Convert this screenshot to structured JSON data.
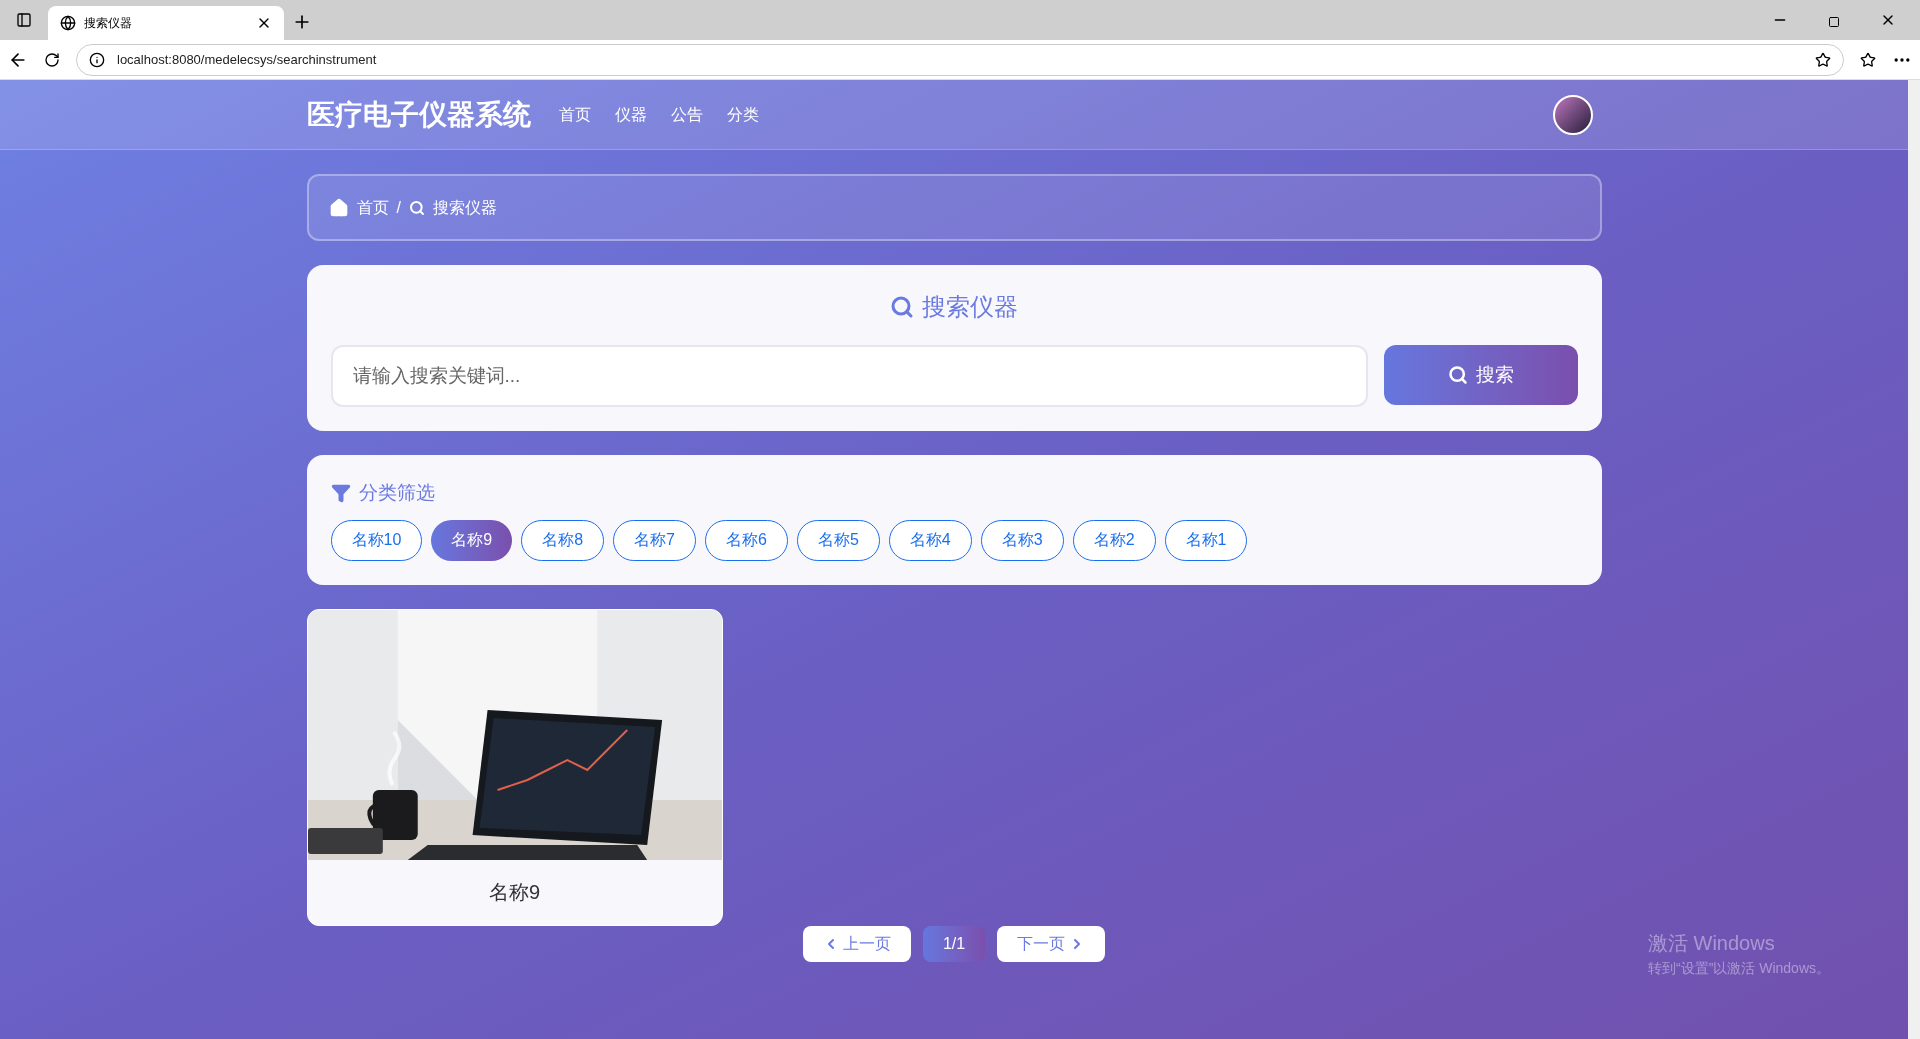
{
  "browser": {
    "tab_title": "搜索仪器",
    "url": "localhost:8080/medelecsys/searchinstrument"
  },
  "header": {
    "logo": "医疗电子仪器系统",
    "nav": [
      {
        "label": "首页"
      },
      {
        "label": "仪器"
      },
      {
        "label": "公告"
      },
      {
        "label": "分类"
      }
    ]
  },
  "breadcrumb": [
    {
      "kind": "home",
      "label": "首页"
    },
    {
      "kind": "search",
      "label": "搜索仪器"
    }
  ],
  "breadcrumb_separator": "/",
  "search": {
    "title": "搜索仪器",
    "placeholder": "请输入搜索关键词...",
    "button": "搜索"
  },
  "filter": {
    "title": "分类筛选",
    "categories": [
      {
        "label": "名称10",
        "selected": false
      },
      {
        "label": "名称9",
        "selected": true
      },
      {
        "label": "名称8",
        "selected": false
      },
      {
        "label": "名称7",
        "selected": false
      },
      {
        "label": "名称6",
        "selected": false
      },
      {
        "label": "名称5",
        "selected": false
      },
      {
        "label": "名称4",
        "selected": false
      },
      {
        "label": "名称3",
        "selected": false
      },
      {
        "label": "名称2",
        "selected": false
      },
      {
        "label": "名称1",
        "selected": false
      }
    ]
  },
  "products": [
    {
      "name": "名称9",
      "kind": "picture"
    }
  ],
  "pagination": {
    "prev": "上一页",
    "page": "1/1",
    "next": "下一页"
  },
  "os_watermark": {
    "title": "激活 Windows",
    "subtitle": "转到“设置”以激活 Windows。"
  }
}
